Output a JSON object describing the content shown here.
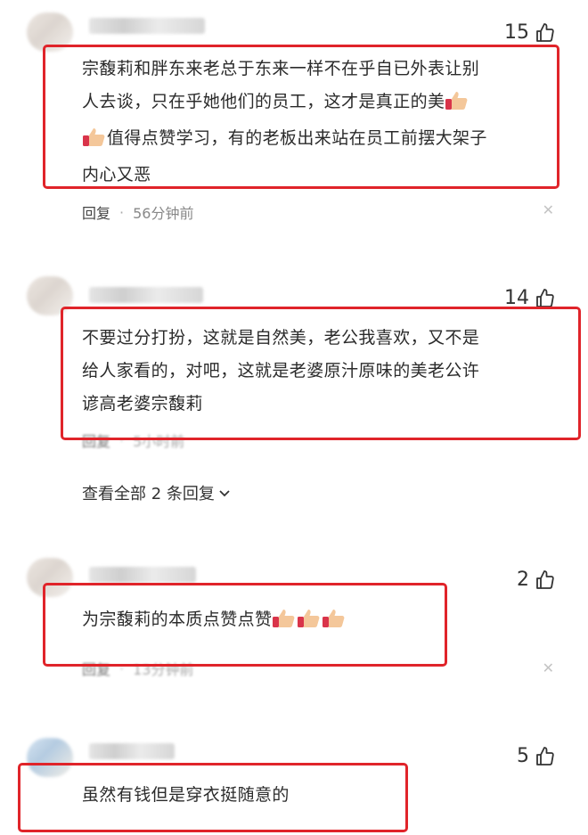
{
  "comments": [
    {
      "likes": "15",
      "text_line1": "宗馥莉和胖东来老总于东来一样不在乎自已外表让别",
      "text_line2": "人去谈，只在乎她他们的员工，这才是真正的美",
      "text_line3": "值得点赞学习，有的老板出来站在员工前摆大架子",
      "text_line4": "内心又恶",
      "reply_label": "回复",
      "time": "56分钟前"
    },
    {
      "likes": "14",
      "text_line1": "不要过分打扮，这就是自然美，老公我喜欢，又不是",
      "text_line2": "给人家看的，对吧，这就是老婆原汁原味的美老公许",
      "text_line3": "谚高老婆宗馥莉",
      "reply_label": "回复",
      "time": "5小时前",
      "view_all_replies": "查看全部 2 条回复"
    },
    {
      "likes": "2",
      "text": "为宗馥莉的本质点赞点赞",
      "reply_label": "回复",
      "time": "13分钟前"
    },
    {
      "likes": "5",
      "text": "虽然有钱但是穿衣挺随意的"
    }
  ],
  "icons": {
    "like": "thumbs-up-outline-icon",
    "clap_emoji": "thumbs-up-emoji-icon",
    "close": "close-icon",
    "chevron": "chevron-down-icon"
  },
  "colors": {
    "highlight_box": "#e0242a",
    "meta_text": "#888888"
  }
}
